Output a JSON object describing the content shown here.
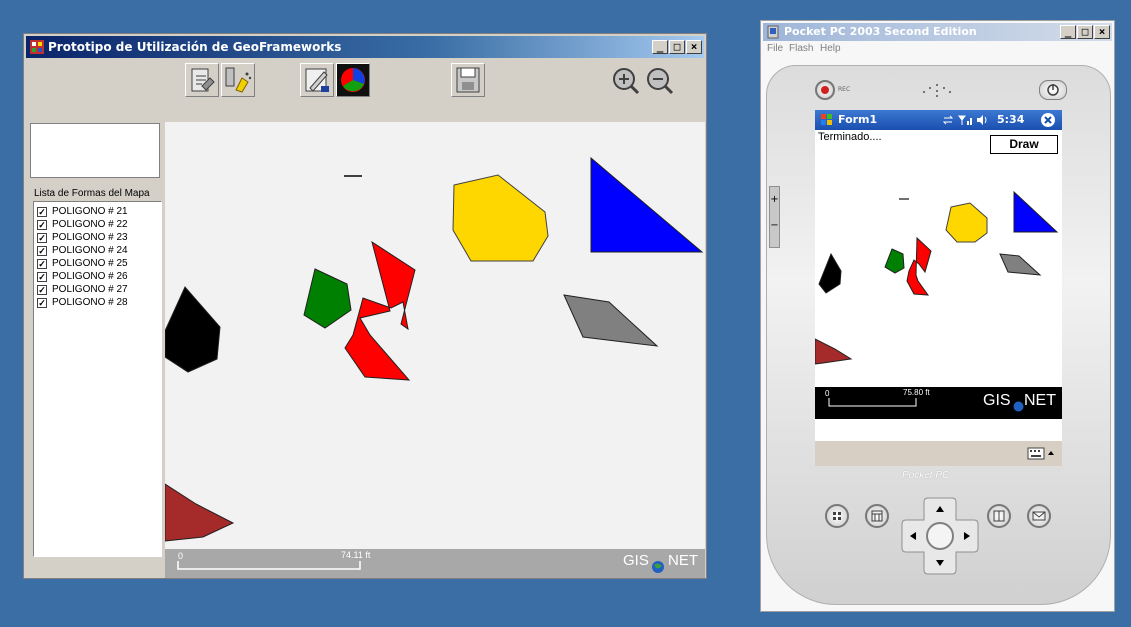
{
  "desktop": {
    "title": "Prototipo de Utilización de GeoFrameworks",
    "list_label": "Lista de Formas del Mapa",
    "shapes": [
      {
        "label": "POLIGONO # 21",
        "checked": true
      },
      {
        "label": "POLIGONO # 22",
        "checked": true
      },
      {
        "label": "POLIGONO # 23",
        "checked": true
      },
      {
        "label": "POLIGONO # 24",
        "checked": true
      },
      {
        "label": "POLIGONO # 25",
        "checked": true
      },
      {
        "label": "POLIGONO # 26",
        "checked": true
      },
      {
        "label": "POLIGONO # 27",
        "checked": true
      },
      {
        "label": "POLIGONO # 28",
        "checked": true
      }
    ],
    "scale_zero": "0",
    "scale_value": "74.11 ft",
    "logo_left": "GIS",
    "logo_right": "NET"
  },
  "pocket": {
    "window_title": "Pocket PC 2003 Second Edition",
    "menu": [
      "File",
      "Flash",
      "Help"
    ],
    "nav_title": "Form1",
    "time": "5:34",
    "status": "Terminado....",
    "draw_label": "Draw",
    "scale_zero": "0",
    "scale_value": "75.80 ft",
    "logo_left": "GIS",
    "logo_right": "NET",
    "brand": "Pocket PC",
    "rec": "REC"
  },
  "colors": {
    "yellow": "#ffd700",
    "blue": "#0000ff",
    "green": "#008000",
    "red": "#ff0000",
    "black": "#000000",
    "gray": "#808080",
    "brown": "#a52a2a"
  }
}
